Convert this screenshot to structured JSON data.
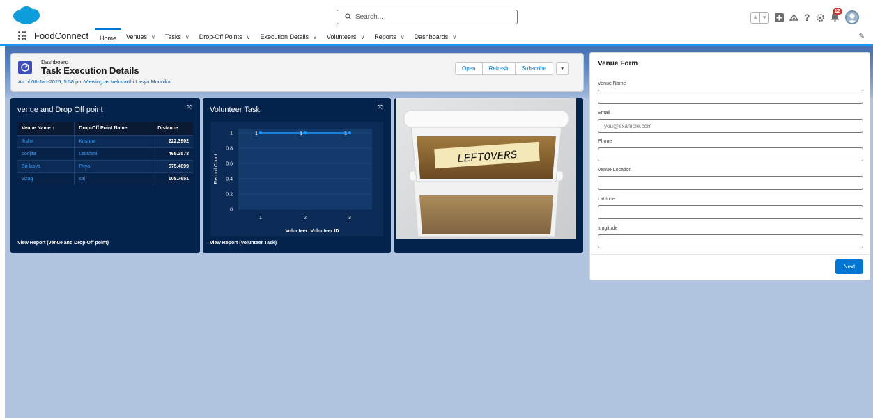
{
  "header": {
    "search_placeholder": "Search...",
    "notification_count": "12",
    "icons": [
      "favorites-star-icon",
      "favorites-list-icon",
      "add-icon",
      "trailhead-icon",
      "help-icon",
      "setup-gear-icon",
      "notification-bell-icon",
      "avatar"
    ]
  },
  "nav": {
    "app_name": "FoodConnect",
    "items": [
      {
        "label": "Home",
        "dropdown": false,
        "active": true
      },
      {
        "label": "Venues",
        "dropdown": true
      },
      {
        "label": "Tasks",
        "dropdown": true
      },
      {
        "label": "Drop-Off Points",
        "dropdown": true
      },
      {
        "label": "Execution Details",
        "dropdown": true
      },
      {
        "label": "Volunteers",
        "dropdown": true
      },
      {
        "label": "Reports",
        "dropdown": true
      },
      {
        "label": "Dashboards",
        "dropdown": true
      }
    ]
  },
  "dashboard": {
    "label": "Dashboard",
    "title": "Task Execution Details",
    "as_of": "As of 06-Jan-2025, 5:58 pm·Viewing as Veluvarthi Lasya Mounika",
    "buttons": {
      "open": "Open",
      "refresh": "Refresh",
      "subscribe": "Subscribe"
    }
  },
  "widget_table": {
    "title": "venue and Drop Off point",
    "columns": [
      "Venue Name ↑",
      "Drop-Off Point Name",
      "Distance"
    ],
    "rows": [
      [
        "Iksha",
        "Krishna",
        "222.3902"
      ],
      [
        "poojita",
        "Lakshmi",
        "465.2573"
      ],
      [
        "Sri lasya",
        "Priya",
        "675.4899"
      ],
      [
        "vizag",
        "sai",
        "108.7651"
      ]
    ],
    "footer": "View Report (venue and Drop Off point)"
  },
  "widget_chart": {
    "title": "Volunteer Task",
    "footer": "View Report (Volunteer Task)"
  },
  "chart_data": {
    "type": "line",
    "x": [
      1,
      2,
      3
    ],
    "values": [
      1,
      1,
      1
    ],
    "data_labels": [
      "1",
      "1",
      "1"
    ],
    "xlabel": "Volunteer: Volunteer ID",
    "ylabel": "Record Count",
    "yticks": [
      "0",
      "0.2",
      "0.4",
      "0.6",
      "0.8",
      "1"
    ],
    "xticks": [
      "1",
      "2",
      "3"
    ],
    "ylim": [
      0,
      1
    ],
    "grid": true,
    "color": "#1b96ff"
  },
  "widget_image": {
    "label_text": "LEFTOVERS"
  },
  "venue_form": {
    "title": "Venue Form",
    "fields": [
      {
        "label": "Venue Name",
        "value": "",
        "placeholder": ""
      },
      {
        "label": "Email",
        "value": "",
        "placeholder": "you@example.com"
      },
      {
        "label": "Phone",
        "value": "",
        "placeholder": ""
      },
      {
        "label": "Venue Location",
        "value": "",
        "placeholder": ""
      },
      {
        "label": "Latitude",
        "value": "",
        "placeholder": ""
      },
      {
        "label": "longitude",
        "value": "",
        "placeholder": ""
      }
    ],
    "next_label": "Next"
  },
  "colors": {
    "brand": "#0176d3",
    "widget_bg": "#03234d",
    "workspace_bg": "#b0c4df"
  }
}
